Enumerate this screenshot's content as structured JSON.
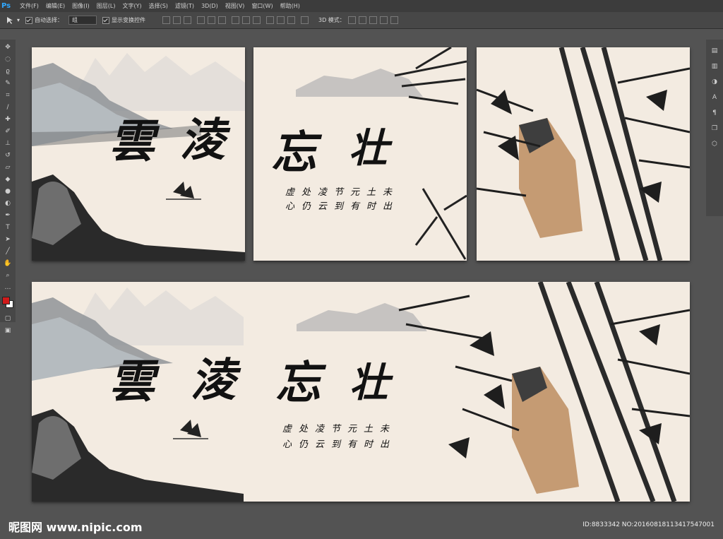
{
  "app": {
    "logo": "Ps"
  },
  "menu": [
    "文件(F)",
    "编辑(E)",
    "图像(I)",
    "图层(L)",
    "文字(Y)",
    "选择(S)",
    "滤镜(T)",
    "3D(D)",
    "视图(V)",
    "窗口(W)",
    "帮助(H)"
  ],
  "options": {
    "auto_select_label": "自动选择：",
    "auto_select_value": "组",
    "show_transform_label": "显示变换控件",
    "mode_3d_label": "3D 模式："
  },
  "artwork": {
    "title_chars": [
      "雲",
      "淩",
      "忘",
      "壮"
    ],
    "poem_line1": "虚处凌节元土未",
    "poem_line2": "心仍云到有时出"
  },
  "watermark": {
    "site": "昵图网 www.nipic.com",
    "id": "ID:8833342 NO:20160818113417547001"
  },
  "colors": {
    "paper": "#f3ebe1",
    "foreground": "#d01a1a",
    "background": "#ffffff"
  }
}
